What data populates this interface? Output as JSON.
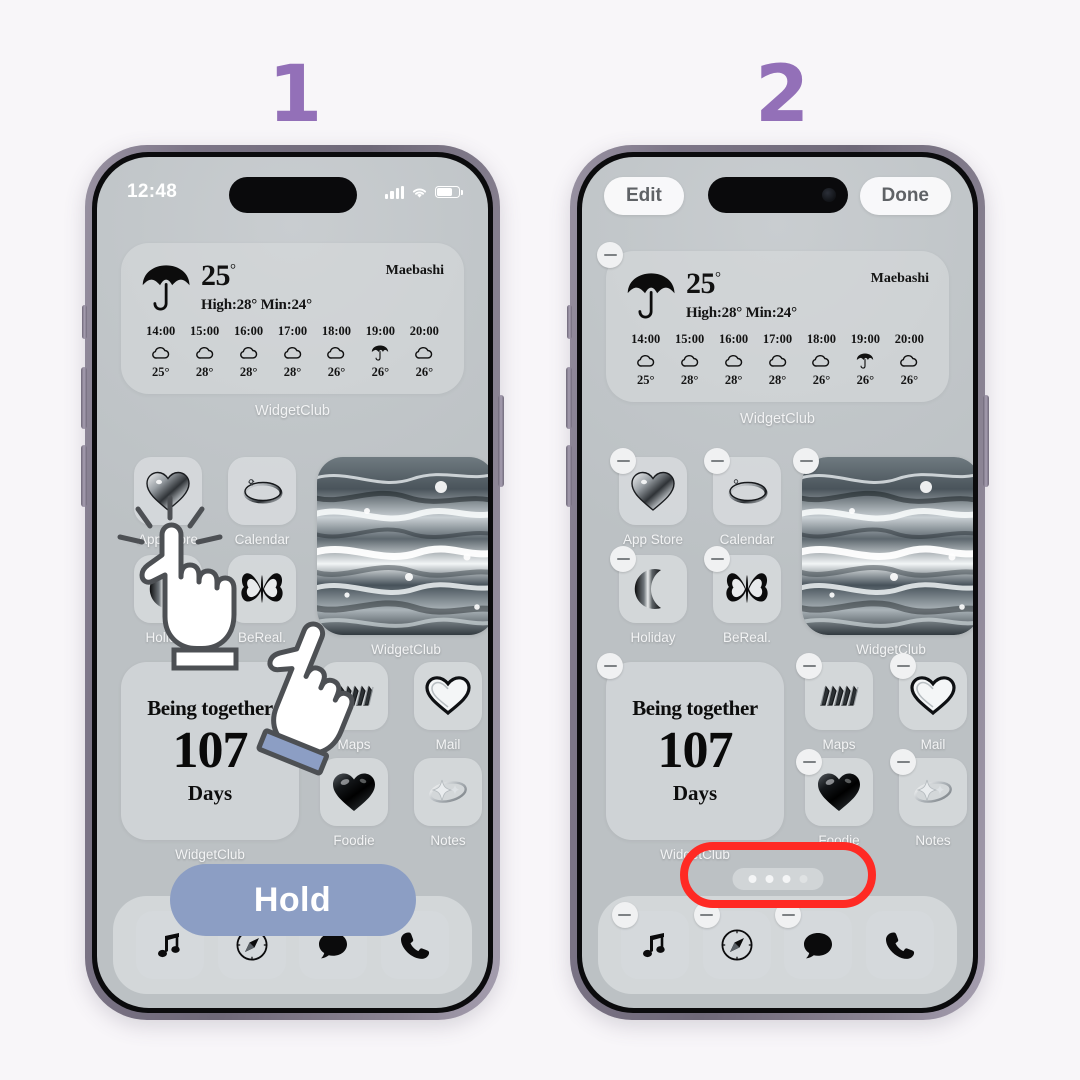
{
  "steps": [
    {
      "number": "1",
      "color": "#9370B8"
    },
    {
      "number": "2",
      "color": "#9370B8"
    }
  ],
  "background_color": "#F8F6F9",
  "phone1": {
    "status_bar": {
      "time": "12:48",
      "signal_icon": "cellular-bars-icon",
      "wifi_icon": "wifi-icon",
      "battery_icon": "battery-icon"
    },
    "mode": "normal",
    "hold_button_label": "Hold",
    "hold_button_color": "#8C9EC4"
  },
  "phone2": {
    "edit_label": "Edit",
    "done_label": "Done",
    "mode": "jiggle",
    "highlight_color": "#FF2A24"
  },
  "weather_widget": {
    "condition_icon": "umbrella-icon",
    "temperature": "25",
    "degree": "°",
    "high_low": "High:28° Min:24°",
    "city": "Maebashi",
    "widget_label": "WidgetClub",
    "hourly": [
      {
        "time": "14:00",
        "icon": "cloud-icon",
        "temp": "25°"
      },
      {
        "time": "15:00",
        "icon": "cloud-icon",
        "temp": "28°"
      },
      {
        "time": "16:00",
        "icon": "cloud-icon",
        "temp": "28°"
      },
      {
        "time": "17:00",
        "icon": "cloud-icon",
        "temp": "28°"
      },
      {
        "time": "18:00",
        "icon": "cloud-icon",
        "temp": "26°"
      },
      {
        "time": "19:00",
        "icon": "umbrella-icon",
        "temp": "26°"
      },
      {
        "time": "20:00",
        "icon": "cloud-icon",
        "temp": "26°"
      }
    ]
  },
  "apps": {
    "app_store": {
      "label": "App Store",
      "icon": "chrome-heart-icon"
    },
    "calendar": {
      "label": "Calendar",
      "icon": "chrome-ring-icon"
    },
    "holiday": {
      "label": "Holiday",
      "icon": "chrome-moon-icon"
    },
    "bereal": {
      "label": "BeReal.",
      "icon": "butterfly-icon"
    },
    "maps": {
      "label": "Maps",
      "icon": "chrome-arrows-icon"
    },
    "mail": {
      "label": "Mail",
      "icon": "outline-heart-icon"
    },
    "foodie": {
      "label": "Foodie",
      "icon": "black-heart-icon"
    },
    "notes": {
      "label": "Notes",
      "icon": "chrome-sparkle-icon"
    }
  },
  "photo_widget": {
    "label": "WidgetClub",
    "icon": "marble-photo"
  },
  "countdown_widget": {
    "title": "Being together",
    "number": "107",
    "unit": "Days",
    "label": "WidgetClub"
  },
  "dock": [
    {
      "name": "music",
      "icon": "music-note-icon"
    },
    {
      "name": "safari",
      "icon": "compass-icon"
    },
    {
      "name": "messages",
      "icon": "chat-bubble-icon"
    },
    {
      "name": "phone",
      "icon": "phone-handset-icon"
    }
  ],
  "page_dots": {
    "count": 4,
    "active_index": 2,
    "bright": 3
  }
}
